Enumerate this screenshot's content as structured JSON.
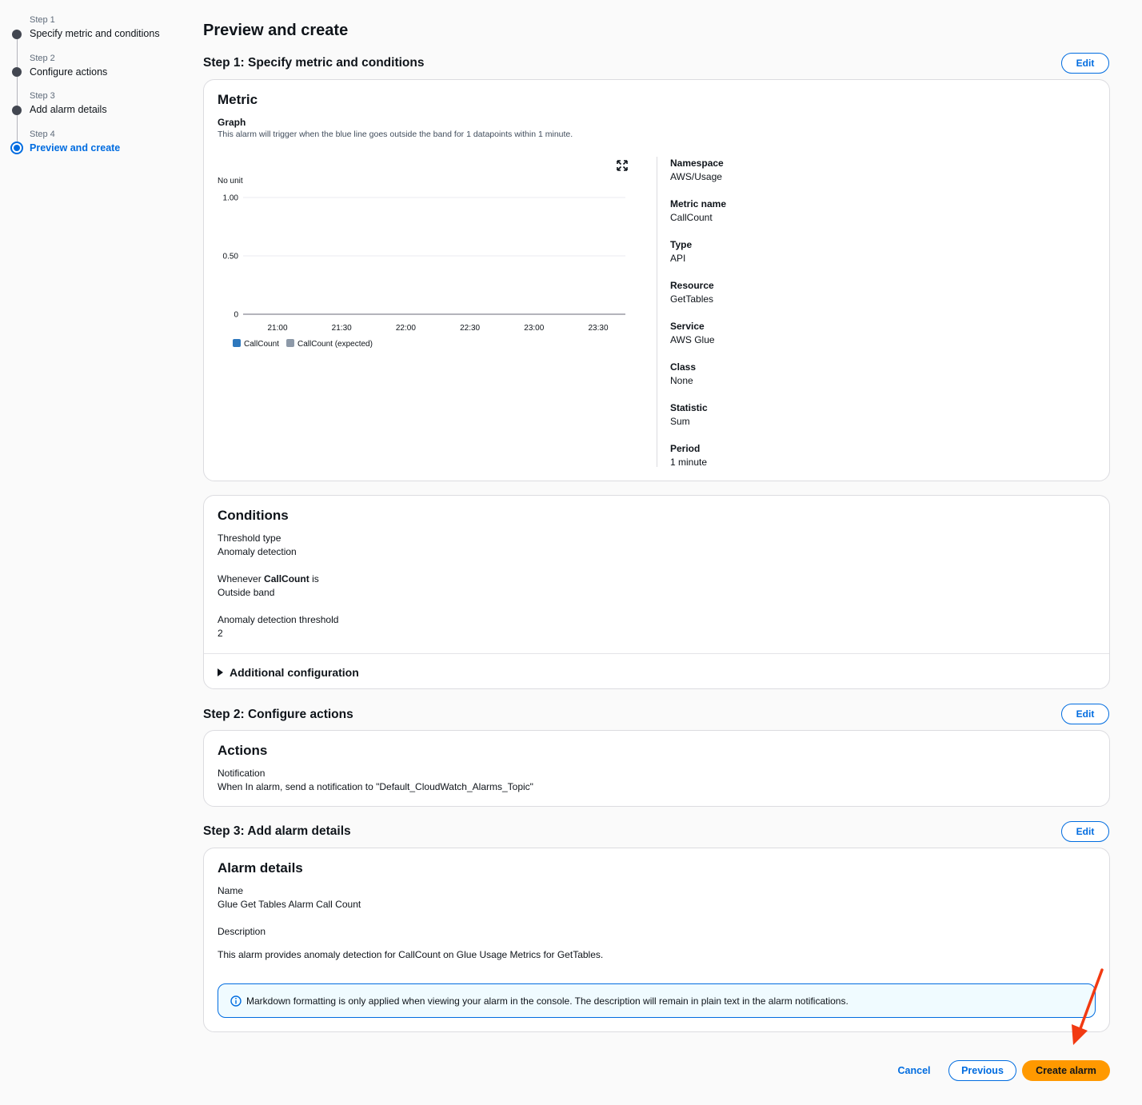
{
  "wizard": {
    "steps": [
      {
        "num": "Step 1",
        "label": "Specify metric and conditions"
      },
      {
        "num": "Step 2",
        "label": "Configure actions"
      },
      {
        "num": "Step 3",
        "label": "Add alarm details"
      },
      {
        "num": "Step 4",
        "label": "Preview and create"
      }
    ],
    "current_step": 4
  },
  "page_title": "Preview and create",
  "step1": {
    "title": "Step 1: Specify metric and conditions",
    "edit_label": "Edit",
    "metric": {
      "title": "Metric",
      "graph_label": "Graph",
      "graph_desc": "This alarm will trigger when the blue line goes outside the band for 1 datapoints within 1 minute.",
      "unit_label": "No unit",
      "details": [
        {
          "key": "Namespace",
          "value": "AWS/Usage"
        },
        {
          "key": "Metric name",
          "value": "CallCount"
        },
        {
          "key": "Type",
          "value": "API"
        },
        {
          "key": "Resource",
          "value": "GetTables"
        },
        {
          "key": "Service",
          "value": "AWS Glue"
        },
        {
          "key": "Class",
          "value": "None"
        },
        {
          "key": "Statistic",
          "value": "Sum"
        },
        {
          "key": "Period",
          "value": "1 minute"
        }
      ]
    },
    "conditions": {
      "title": "Conditions",
      "threshold_type_label": "Threshold type",
      "threshold_type_value": "Anomaly detection",
      "whenever_prefix": "Whenever",
      "whenever_metric": "CallCount",
      "whenever_suffix": "is",
      "whenever_value": "Outside band",
      "threshold_label": "Anomaly detection threshold",
      "threshold_value": "2",
      "additional_config": "Additional configuration"
    }
  },
  "step2": {
    "title": "Step 2: Configure actions",
    "edit_label": "Edit",
    "actions": {
      "title": "Actions",
      "notification_label": "Notification",
      "notification_value": "When In alarm, send a notification to \"Default_CloudWatch_Alarms_Topic\""
    }
  },
  "step3": {
    "title": "Step 3: Add alarm details",
    "edit_label": "Edit",
    "details": {
      "title": "Alarm details",
      "name_label": "Name",
      "name_value": "Glue Get Tables Alarm Call Count",
      "description_label": "Description",
      "description_value": "This alarm provides anomaly detection for CallCount on Glue Usage Metrics for GetTables.",
      "info": "Markdown formatting is only applied when viewing your alarm in the console. The description will remain in plain text in the alarm notifications."
    }
  },
  "footer": {
    "cancel": "Cancel",
    "previous": "Previous",
    "create": "Create alarm"
  },
  "colors": {
    "accent": "#006ce0",
    "primary_button": "#ff9900",
    "series_actual": "#2e78bd",
    "series_expected": "#8d99a8",
    "annotation_arrow": "#f23a12"
  },
  "chart_data": {
    "type": "line",
    "ylabel": "No unit",
    "ylim": [
      0,
      1
    ],
    "y_ticks": [
      "1.00",
      "0.50",
      "0"
    ],
    "y_tick_values": [
      1,
      0.5,
      0
    ],
    "x_ticks": [
      "21:00",
      "21:30",
      "22:00",
      "22:30",
      "23:00",
      "23:30"
    ],
    "grid": true,
    "legend_placement": "bottom-left",
    "series": [
      {
        "name": "CallCount",
        "values": []
      },
      {
        "name": "CallCount (expected)",
        "values": []
      }
    ]
  }
}
